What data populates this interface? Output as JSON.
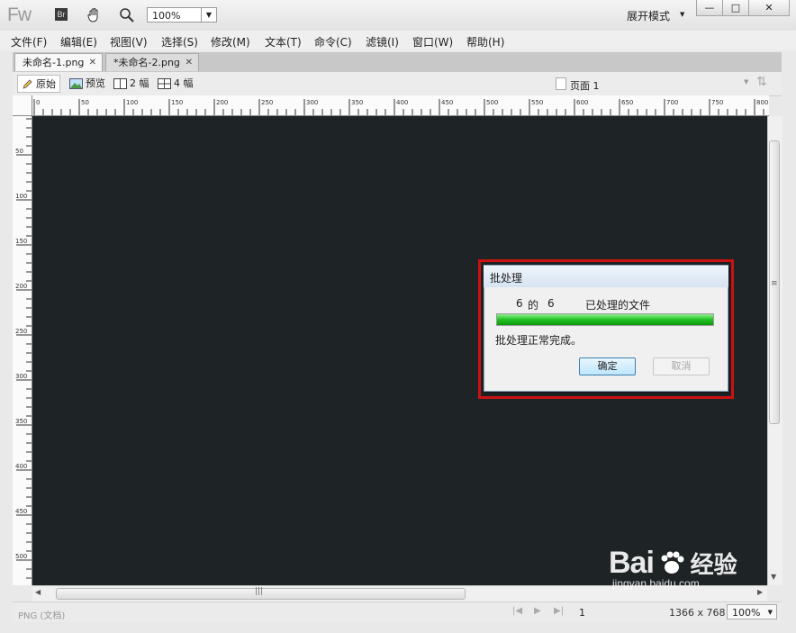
{
  "app": {
    "logo": "Fw",
    "bridge_label": "Br",
    "zoom": "100%",
    "layout_mode": "展开模式",
    "window_buttons": {
      "min": "—",
      "max": "□",
      "close": "✕"
    }
  },
  "menu": [
    "文件(F)",
    "编辑(E)",
    "视图(V)",
    "选择(S)",
    "修改(M)",
    "文本(T)",
    "命令(C)",
    "滤镜(I)",
    "窗口(W)",
    "帮助(H)"
  ],
  "tabs": [
    {
      "label": "未命名-1.png",
      "close": "✕"
    },
    {
      "label": "*未命名-2.png",
      "close": "✕"
    }
  ],
  "view_bar": {
    "original": "原始",
    "preview": "预览",
    "two_up": "2 幅",
    "four_up": "4 幅",
    "page": "页面 1"
  },
  "ruler": {
    "top_labels": [
      "0",
      "50",
      "100",
      "150",
      "200",
      "250",
      "300",
      "350",
      "400",
      "450",
      "500",
      "550",
      "600",
      "650",
      "700",
      "750",
      "800"
    ],
    "left_labels": [
      "50",
      "100",
      "150",
      "200",
      "250",
      "300",
      "350",
      "400",
      "450",
      "500"
    ]
  },
  "status": {
    "doc_type": "PNG (文档)",
    "page_number": "1",
    "dimensions": "1366 x 768",
    "zoom": "100%"
  },
  "dialog": {
    "title": "批处理",
    "count_current": "6",
    "count_of": "的",
    "count_total": "6",
    "processed_label": "已处理的文件",
    "progress": 1.0,
    "message": "批处理正常完成。",
    "ok_label": "确定",
    "cancel_label": "取消",
    "highlight_color": "#cc1111"
  },
  "watermark": {
    "brand": "Bai",
    "brand_suffix": "经验",
    "url": "jingyan.baidu.com"
  }
}
